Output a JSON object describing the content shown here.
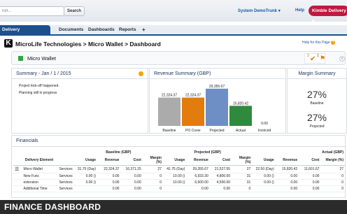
{
  "topbar": {
    "search_placeholder": "rch...",
    "search_button": "Search",
    "user_menu": "System DemoTrunk",
    "help": "Help",
    "app_button": "Kimble Delivery"
  },
  "tabs": [
    {
      "label": "Delivery Engagements"
    },
    {
      "label": "Documents"
    },
    {
      "label": "Dashboards"
    },
    {
      "label": "Reports"
    },
    {
      "label": "+"
    }
  ],
  "page": {
    "title": "MicroLife Technologies > Micro Wallet > Dashboard",
    "help_link": "Help for this Page",
    "project_name": "Micro Wallet",
    "badge_count_1": "3",
    "badge_count_2": "1"
  },
  "summary": {
    "title": "Summary - Jan / 1 / 2015",
    "line1": "Project kick-off happened.",
    "line2": "Planning still in progress",
    "status_color": "#f2a600"
  },
  "revenue_panel": {
    "title": "Revenue Summary (GBP)"
  },
  "chart_data": {
    "type": "bar",
    "categories": [
      "Baseline",
      "PO Cover",
      "Projected",
      "Actual",
      "Invoiced"
    ],
    "values": [
      22324.37,
      22324.37,
      29355.67,
      15820.42,
      0
    ],
    "value_labels": [
      "22,324.37",
      "22,324.37",
      "29,355.67",
      "15,820.42",
      "0.00"
    ],
    "colors": [
      "#ababab",
      "#e27c0d",
      "#6d8fc5",
      "#2f8a3e",
      "#888888"
    ],
    "ylim": [
      0,
      32000
    ],
    "grid": false,
    "legend": "none"
  },
  "margin_panel": {
    "title": "Margin Summary",
    "baseline_value": "27%",
    "baseline_label": "Baseline",
    "projected_value": "27%",
    "projected_label": "Projected"
  },
  "financials": {
    "title": "Financials",
    "group_headers": [
      "Baseline (GBP)",
      "Projected (GBP)",
      "Actual (GBP)"
    ],
    "columns": [
      "Delivery Element",
      "",
      "Usage",
      "Revenue",
      "Cost",
      "Margin (%)",
      "Usage",
      "Revenue",
      "Cost",
      "Margin (%)",
      "Usage",
      "Revenue",
      "Cost",
      "Margin (%)"
    ],
    "rows": [
      [
        "Micro Wallet",
        "Services",
        "31.75 (Day)",
        "22,324.37",
        "16,371.25",
        "27",
        "41.75 (Day)",
        "29,355.67",
        "21,527.55",
        "27",
        "22.50 (Day)",
        "15,820.42",
        "11,601.67",
        "27"
      ],
      [
        "New Func",
        "Services",
        "0.00 ()",
        "0.00",
        "0.00",
        "0",
        "10.00 ()",
        "6,933.30",
        "4,800.00",
        "31",
        "0.00 ()",
        "0.00",
        "0.00",
        "0"
      ],
      [
        "extension",
        "Services",
        "0.00 ()",
        "0.00",
        "0.00",
        "0",
        "10.00 ()",
        "6,500.00",
        "4,500.00",
        "31",
        "0.00 ()",
        "0.00",
        "0.00",
        "0"
      ],
      [
        "Additional Time",
        "Services",
        "",
        "0.00",
        "0.00",
        "0",
        "",
        "0.00",
        "0.00",
        "0",
        "",
        "0.00",
        "0.00",
        "0"
      ]
    ]
  },
  "banner": {
    "text": "FINANCE DASHBOARD"
  }
}
